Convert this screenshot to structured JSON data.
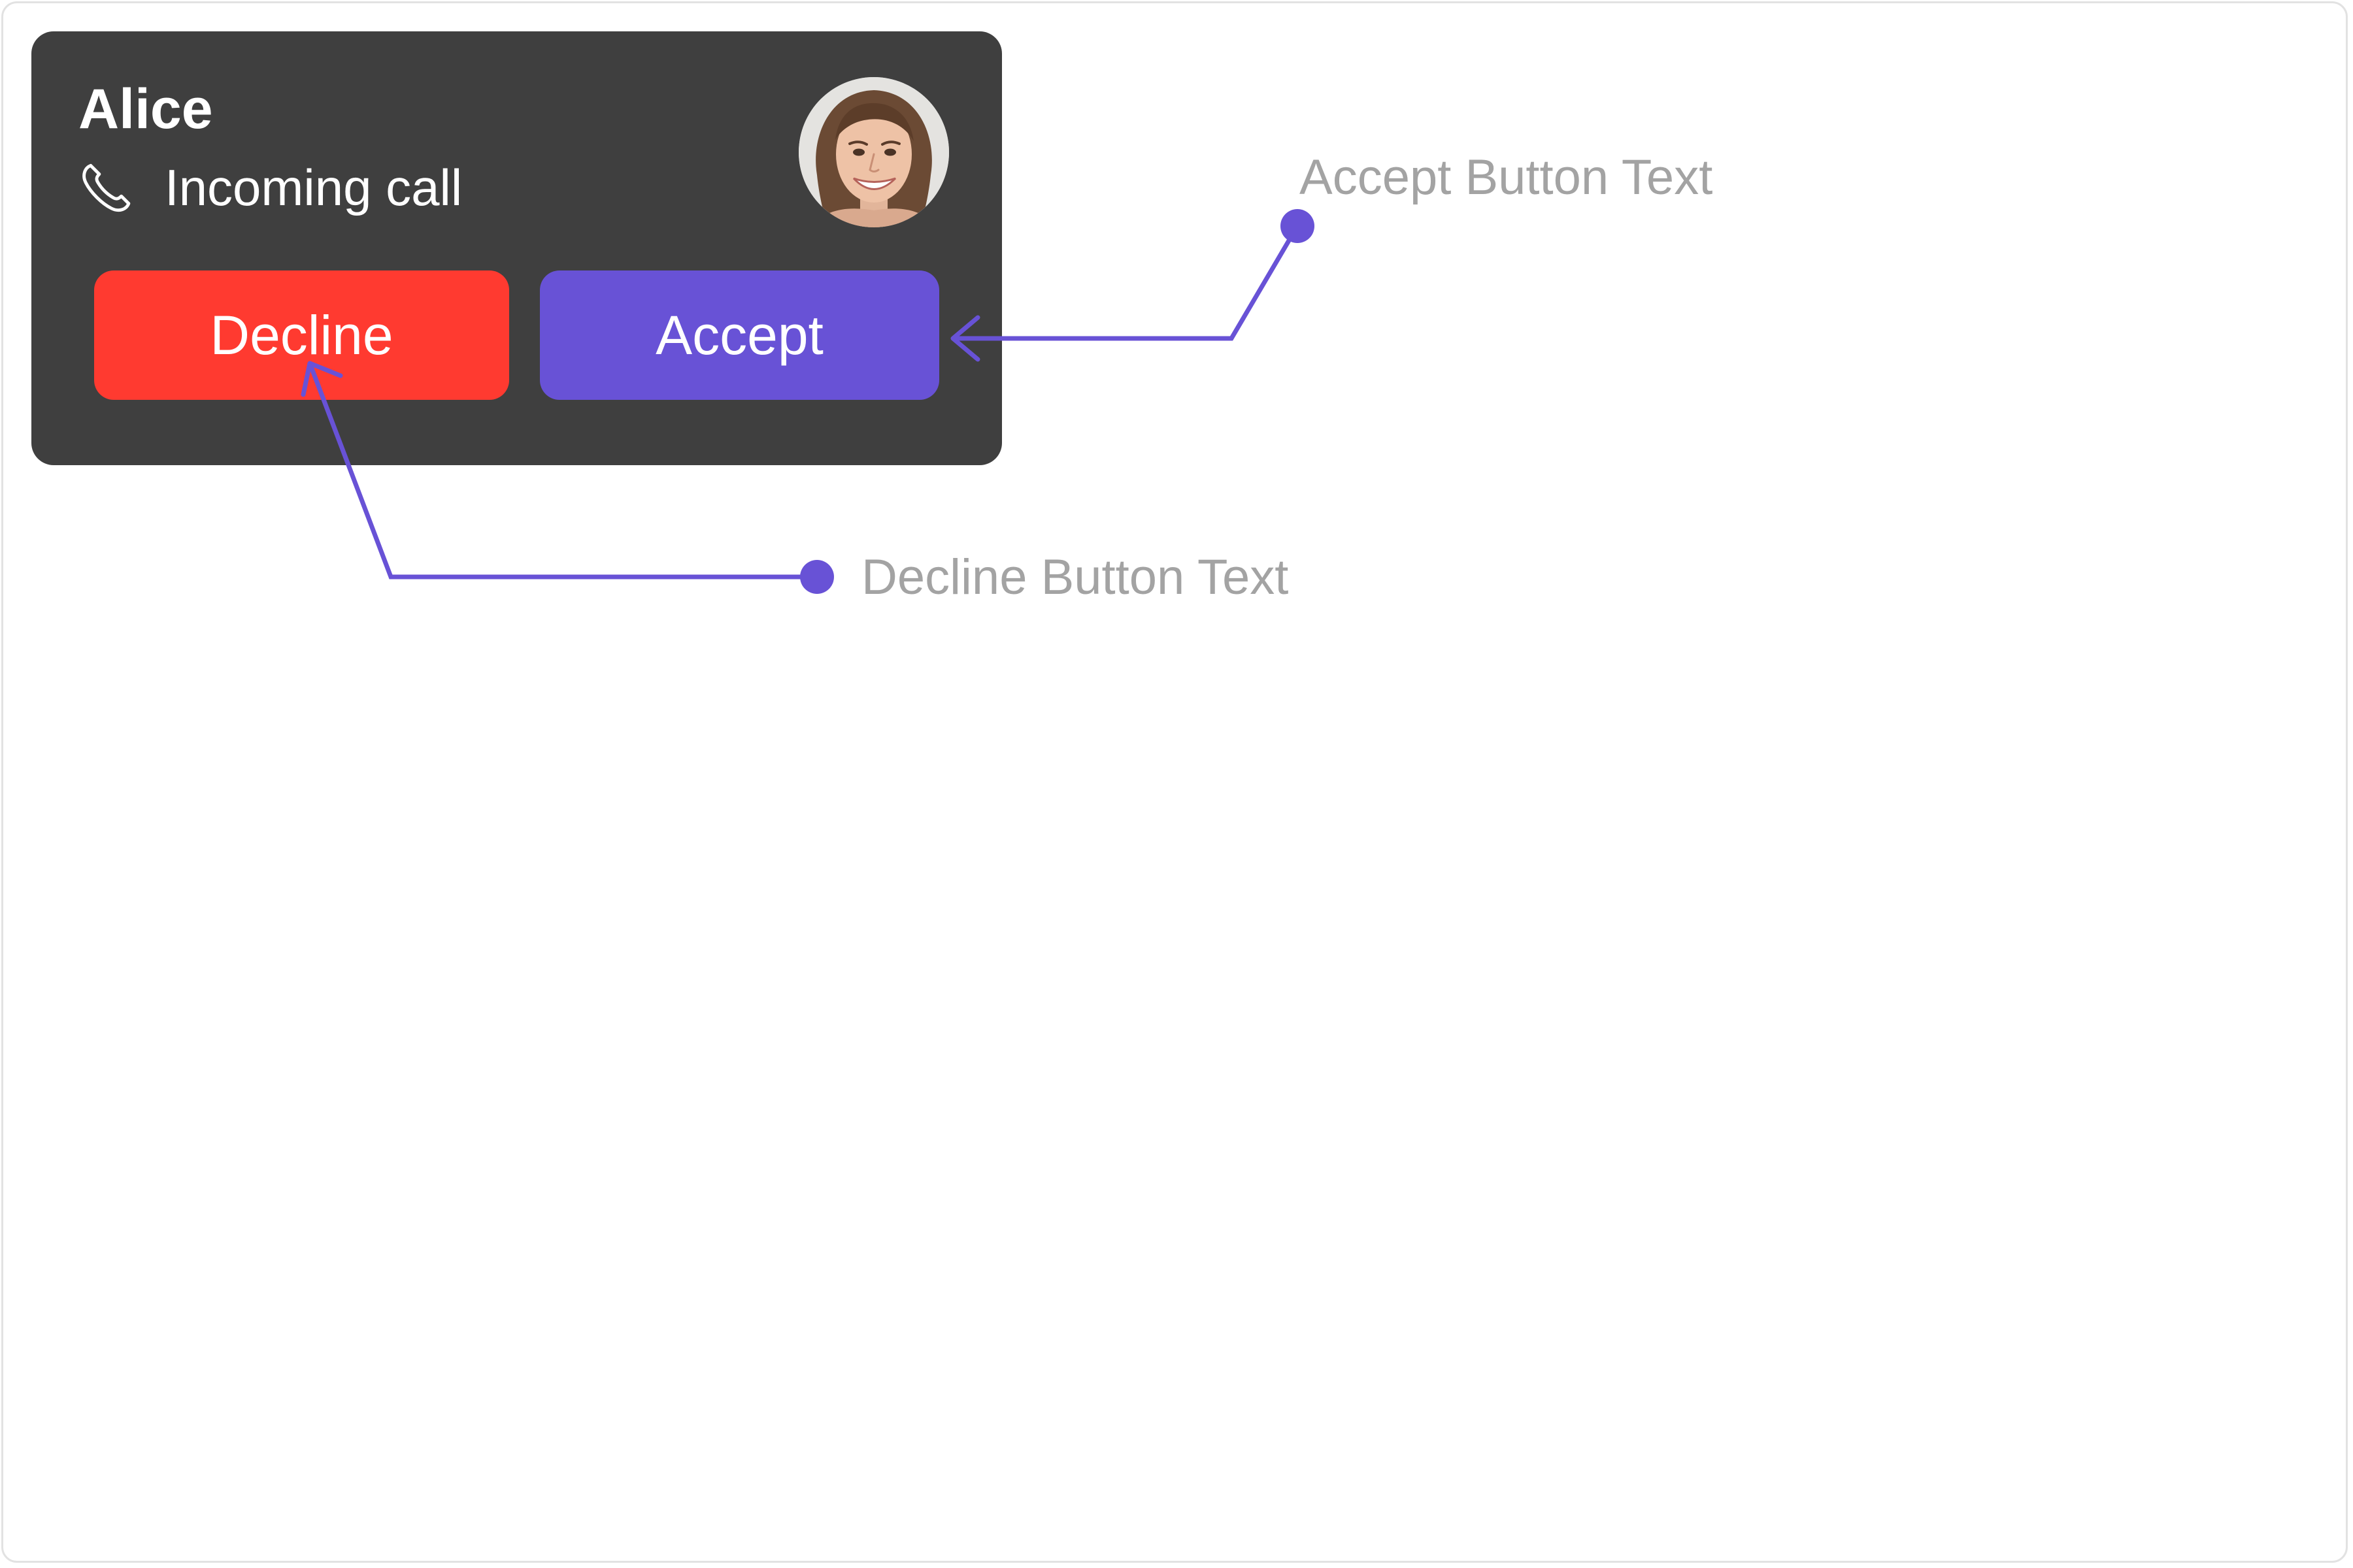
{
  "call": {
    "caller_name": "Alice",
    "status_text": "Incoming call",
    "status_icon": "phone-icon",
    "avatar": "avatar-photo"
  },
  "buttons": {
    "decline_label": "Decline",
    "accept_label": "Accept"
  },
  "annotations": {
    "accept": "Accept Button Text",
    "decline": "Decline Button Text"
  },
  "colors": {
    "card_bg": "#3f3f3f",
    "decline": "#ff3a30",
    "accept": "#6852d6",
    "annotation": "#6852d6",
    "annotation_text": "#a3a3a3"
  }
}
